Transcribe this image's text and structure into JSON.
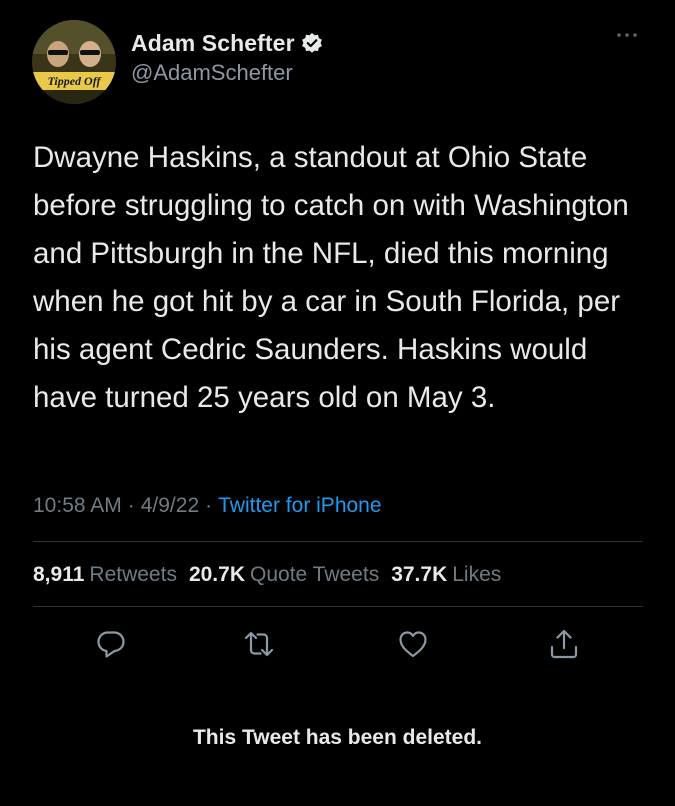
{
  "author": {
    "display_name": "Adam Schefter",
    "handle": "@AdamSchefter",
    "verified": true,
    "avatar_caption": "Tipped Off"
  },
  "tweet": {
    "text": "Dwayne Haskins, a standout at Ohio State before struggling to catch on with Washington and Pittsburgh in the NFL, died this morning when he got hit by a car in South Florida, per his agent Cedric Saunders. Haskins would have turned 25 years old on May 3.",
    "time": "10:58 AM",
    "date": "4/9/22",
    "separator": "·",
    "source": "Twitter for iPhone"
  },
  "stats": {
    "retweets_count": "8,911",
    "retweets_label": "Retweets",
    "quote_count": "20.7K",
    "quote_label": "Quote Tweets",
    "likes_count": "37.7K",
    "likes_label": "Likes"
  },
  "actions": [
    {
      "icon": "reply-icon"
    },
    {
      "icon": "retweet-icon"
    },
    {
      "icon": "like-icon"
    },
    {
      "icon": "share-icon"
    }
  ],
  "footer": {
    "deleted_notice": "This Tweet has been deleted."
  },
  "colors": {
    "background": "#000000",
    "text": "#e7e9ea",
    "secondary": "#717b84",
    "accent": "#1d9bf0",
    "divider": "#2f3336"
  }
}
